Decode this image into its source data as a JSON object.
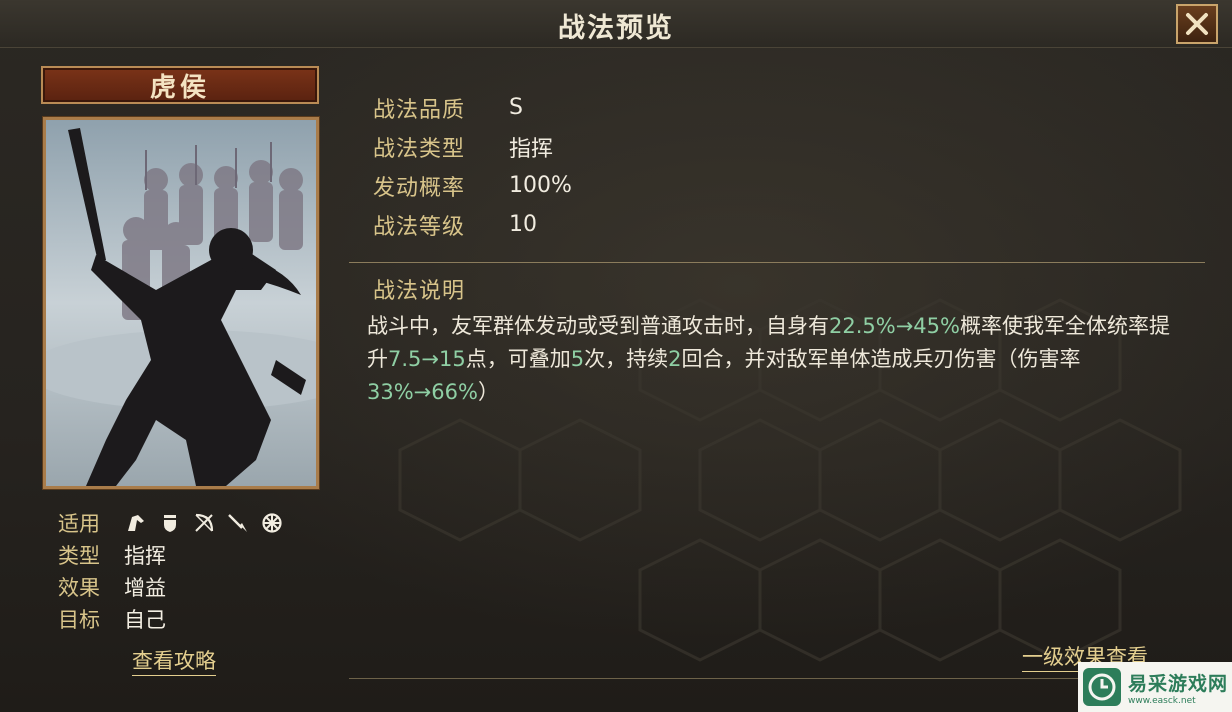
{
  "header": {
    "title": "战法预览"
  },
  "skill": {
    "name": "虎侯",
    "props": [
      {
        "key": "适用",
        "value": ""
      },
      {
        "key": "类型",
        "value": "指挥"
      },
      {
        "key": "效果",
        "value": "增益"
      },
      {
        "key": "目标",
        "value": "自己"
      }
    ],
    "applicable_icons": [
      "cavalry-icon",
      "shield-icon",
      "bow-icon",
      "spear-icon",
      "wheel-icon"
    ],
    "guide_link": "查看攻略"
  },
  "stats": [
    {
      "key": "战法品质",
      "value": "S"
    },
    {
      "key": "战法类型",
      "value": "指挥"
    },
    {
      "key": "发动概率",
      "value": "100%"
    },
    {
      "key": "战法等级",
      "value": "10"
    }
  ],
  "description": {
    "title": "战法说明",
    "parts": [
      {
        "t": "战斗中，友军群体发动或受到普通攻击时，自身有",
        "hl": false
      },
      {
        "t": "22.5%→45%",
        "hl": true
      },
      {
        "t": "概率使我军全体统率提升",
        "hl": false
      },
      {
        "t": "7.5→15",
        "hl": true
      },
      {
        "t": "点，可叠加",
        "hl": false
      },
      {
        "t": "5",
        "hl": true
      },
      {
        "t": "次，持续",
        "hl": false
      },
      {
        "t": "2",
        "hl": true
      },
      {
        "t": "回合，并对敌军单体造成兵刃伤害（伤害率",
        "hl": false
      },
      {
        "t": "33%→66%",
        "hl": true
      },
      {
        "t": "）",
        "hl": false
      }
    ]
  },
  "effect_link": "一级效果查看",
  "watermark": {
    "cn": "易采游戏网",
    "en": "www.easck.net"
  },
  "colors": {
    "gold": "#d8c48a",
    "highlight": "#8fcfa4",
    "plate": "#7a3318"
  }
}
